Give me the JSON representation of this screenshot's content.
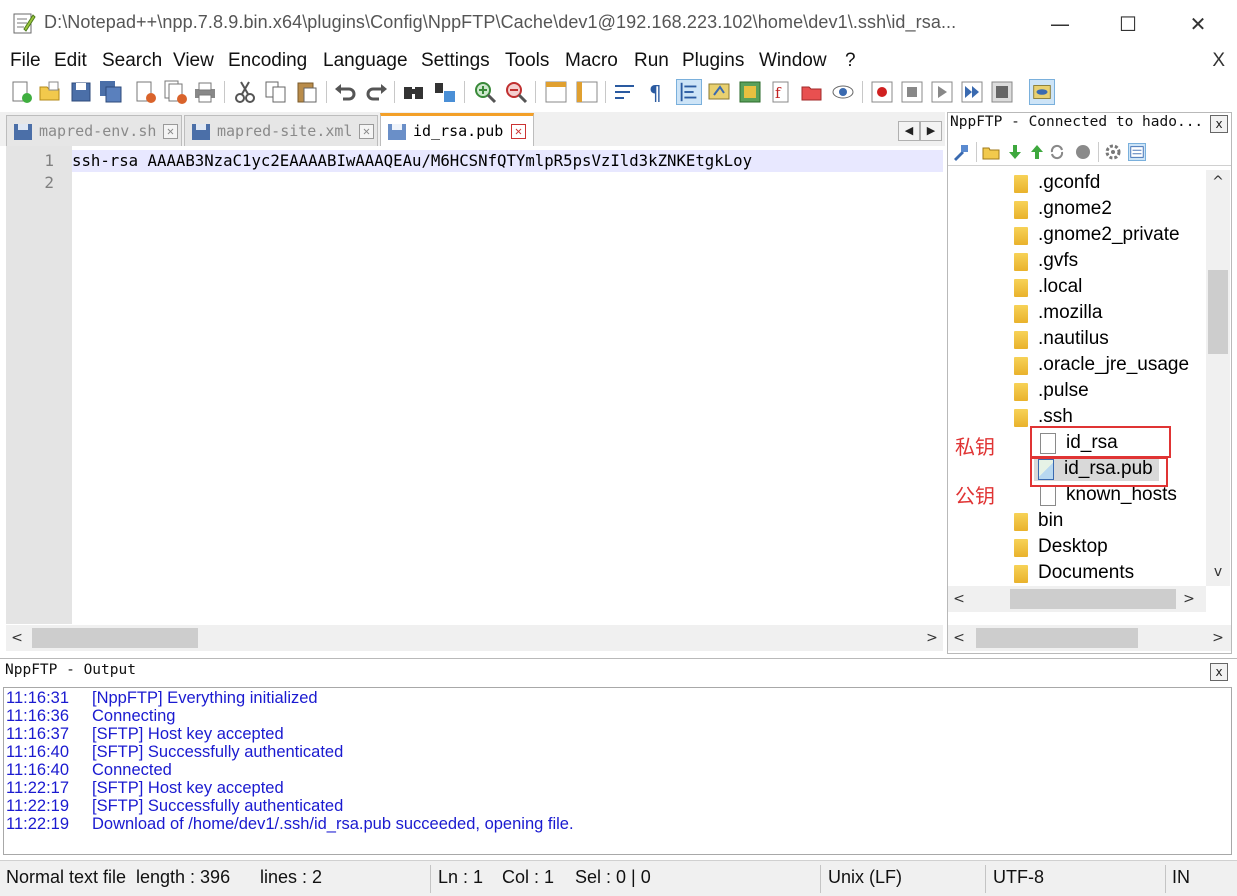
{
  "window": {
    "title": "D:\\Notepad++\\npp.7.8.9.bin.x64\\plugins\\Config\\NppFTP\\Cache\\dev1@192.168.223.102\\home\\dev1\\.ssh\\id_rsa...",
    "minimize": "—",
    "maximize": "☐",
    "close": "✕"
  },
  "menu": {
    "items": [
      "File",
      "Edit",
      "Search",
      "View",
      "Encoding",
      "Language",
      "Settings",
      "Tools",
      "Macro",
      "Run",
      "Plugins",
      "Window",
      "?"
    ],
    "close": "X"
  },
  "tabs": [
    {
      "label": "mapred-env.sh",
      "active": false
    },
    {
      "label": "mapred-site.xml",
      "active": false
    },
    {
      "label": "id_rsa.pub",
      "active": true
    }
  ],
  "tab_close_glyph": "✕",
  "tab_nav": {
    "prev": "◀",
    "next": "▶"
  },
  "editor": {
    "line_numbers": [
      "1",
      "2"
    ],
    "lines": [
      "ssh-rsa AAAAB3NzaC1yc2EAAAABIwAAAQEAu/M6HCSNfQTYmlpR5psVzIld3kZNKEtgkLoy",
      ""
    ]
  },
  "scroll_glyphs": {
    "left": "<",
    "right": ">",
    "up": "^",
    "down": "v"
  },
  "ftp_panel": {
    "title": "NppFTP - Connected to hado...",
    "close": "x",
    "tree": [
      {
        "label": ".gconfd",
        "type": "folder"
      },
      {
        "label": ".gnome2",
        "type": "folder"
      },
      {
        "label": ".gnome2_private",
        "type": "folder"
      },
      {
        "label": ".gvfs",
        "type": "folder"
      },
      {
        "label": ".local",
        "type": "folder"
      },
      {
        "label": ".mozilla",
        "type": "folder"
      },
      {
        "label": ".nautilus",
        "type": "folder"
      },
      {
        "label": ".oracle_jre_usage",
        "type": "folder"
      },
      {
        "label": ".pulse",
        "type": "folder"
      },
      {
        "label": ".ssh",
        "type": "folder"
      },
      {
        "label": "id_rsa",
        "type": "file"
      },
      {
        "label": "id_rsa.pub",
        "type": "file",
        "selected": true
      },
      {
        "label": "known_hosts",
        "type": "file"
      },
      {
        "label": "bin",
        "type": "folder"
      },
      {
        "label": "Desktop",
        "type": "folder"
      },
      {
        "label": "Documents",
        "type": "folder"
      }
    ],
    "annotations": {
      "private_key": "私钥",
      "public_key": "公钥"
    }
  },
  "output": {
    "title": "NppFTP - Output",
    "close": "x",
    "log": [
      {
        "time": "11:16:31",
        "message": "[NppFTP] Everything initialized"
      },
      {
        "time": "11:16:36",
        "message": "Connecting"
      },
      {
        "time": "11:16:37",
        "message": "[SFTP] Host key accepted"
      },
      {
        "time": "11:16:40",
        "message": "[SFTP] Successfully authenticated"
      },
      {
        "time": "11:16:40",
        "message": "Connected"
      },
      {
        "time": "11:22:17",
        "message": "[SFTP] Host key accepted"
      },
      {
        "time": "11:22:19",
        "message": "[SFTP] Successfully authenticated"
      },
      {
        "time": "11:22:19",
        "message": "Download of /home/dev1/.ssh/id_rsa.pub succeeded, opening file."
      }
    ]
  },
  "status": {
    "file_type": "Normal text file",
    "length": "length : 396",
    "lines": "lines : 2",
    "ln": "Ln : 1",
    "col": "Col : 1",
    "sel": "Sel : 0 | 0",
    "eol": "Unix (LF)",
    "encoding": "UTF-8",
    "mode": "IN"
  },
  "colors": {
    "accent_tab": "#f3a028",
    "log_text": "#1a1ad0",
    "annotation": "#e03434",
    "current_line": "#e8e8ff"
  }
}
